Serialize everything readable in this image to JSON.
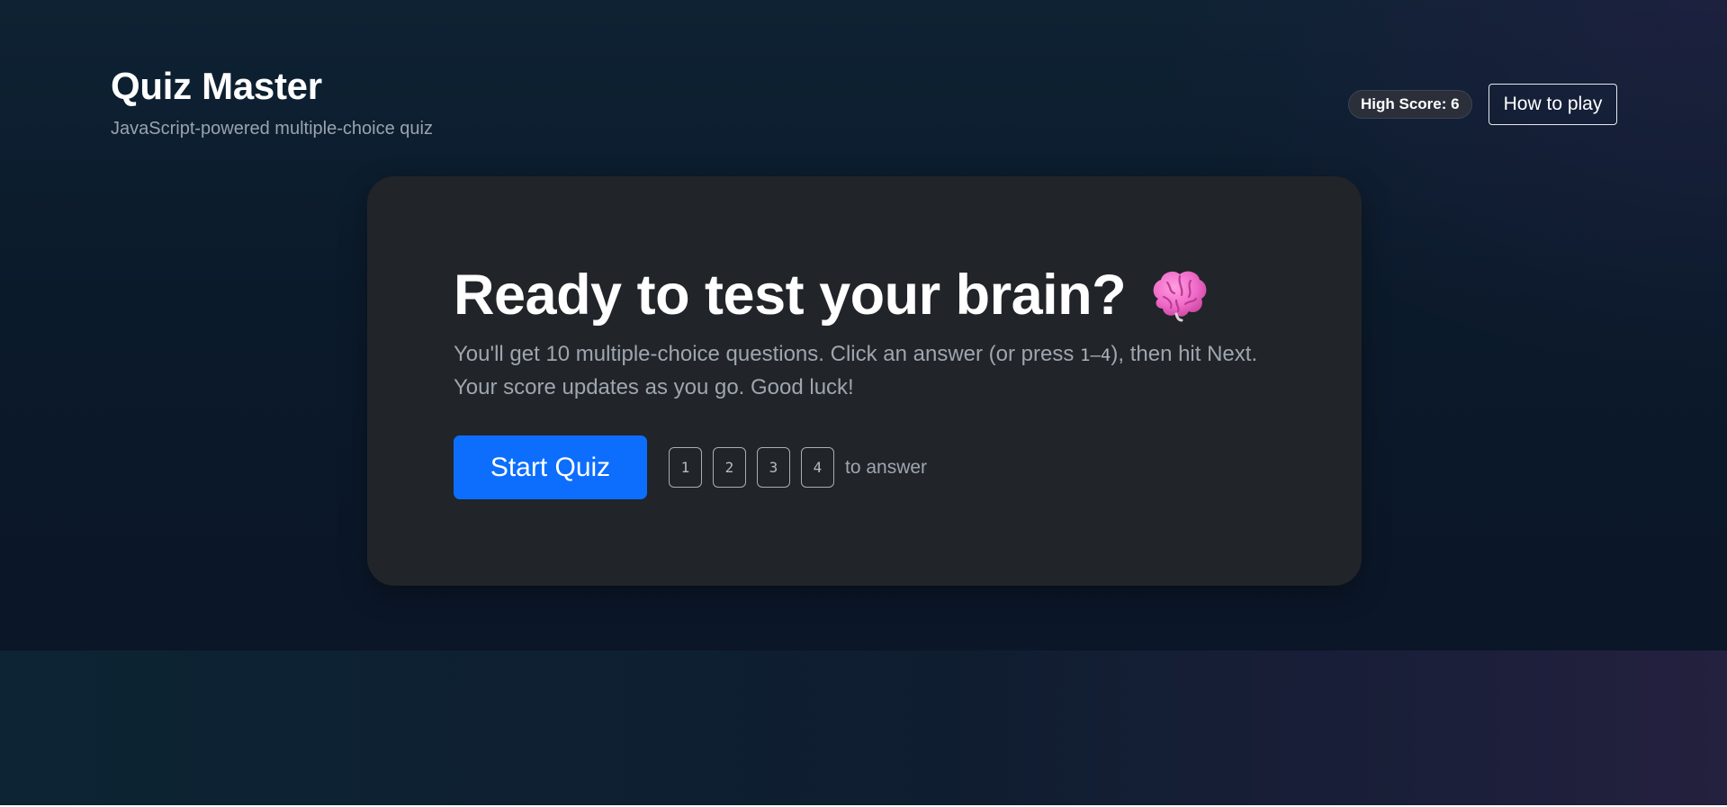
{
  "header": {
    "title": "Quiz Master",
    "subtitle": "JavaScript-powered multiple-choice quiz",
    "high_score_label": "High Score: 6",
    "how_to_play_label": "How to play"
  },
  "intro": {
    "heading": "Ready to test your brain?",
    "heading_icon": "brain-emoji",
    "description_part1": "You'll get 10 multiple-choice questions. Click an answer (or press ",
    "description_keys": "1–4",
    "description_part2": "), then hit Next. Your score updates as you go. Good luck!",
    "start_button_label": "Start Quiz",
    "keys": [
      "1",
      "2",
      "3",
      "4"
    ],
    "keys_hint": "to answer"
  },
  "colors": {
    "accent": "#0d6efd",
    "card_background": "#212429",
    "page_background": "#0b1628",
    "brain_icon": "#f06ac9"
  }
}
